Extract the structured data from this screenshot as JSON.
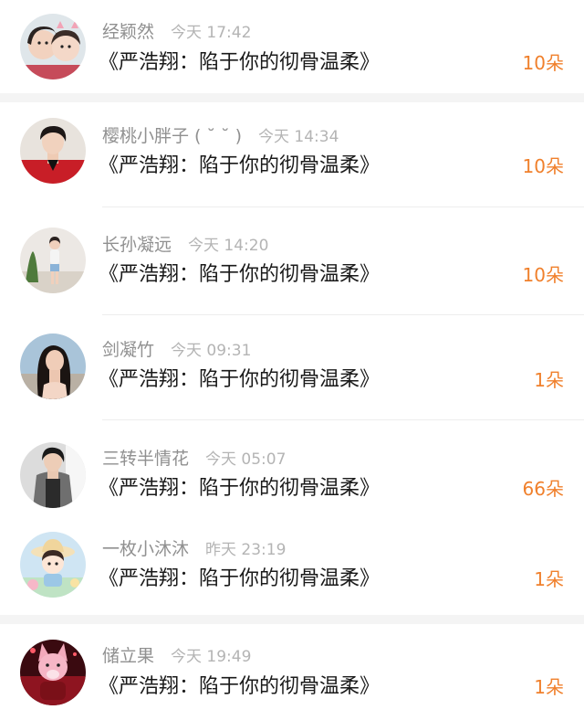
{
  "gifts": [
    {
      "name": "经颖然",
      "time": "今天 17:42",
      "title": "《严浩翔：陷于你的彻骨温柔》",
      "count": "10朵",
      "avatar_icon": "two-girls-selfie-avatar"
    },
    {
      "name": "樱桃小胖子 ( ˘ ˘ )",
      "time": "今天 14:34",
      "title": "《严浩翔：陷于你的彻骨温柔》",
      "count": "10朵",
      "avatar_icon": "boy-red-shirt-avatar"
    },
    {
      "name": "长孙凝远",
      "time": "今天 14:20",
      "title": "《严浩翔：陷于你的彻骨温柔》",
      "count": "10朵",
      "avatar_icon": "girl-full-body-avatar"
    },
    {
      "name": "剑凝竹",
      "time": "今天 09:31",
      "title": "《严浩翔：陷于你的彻骨温柔》",
      "count": "1朵",
      "avatar_icon": "girl-long-hair-avatar"
    },
    {
      "name": "三转半情花",
      "time": "今天 05:07",
      "title": "《严浩翔：陷于你的彻骨温柔》",
      "count": "66朵",
      "avatar_icon": "boy-coat-avatar"
    },
    {
      "name": "一枚小沐沐",
      "time": "昨天 23:19",
      "title": "《严浩翔：陷于你的彻骨温柔》",
      "count": "1朵",
      "avatar_icon": "cartoon-girl-hat-avatar"
    },
    {
      "name": "储立果",
      "time": "今天 19:49",
      "title": "《严浩翔：陷于你的彻骨温柔》",
      "count": "1朵",
      "avatar_icon": "pink-fox-character-avatar"
    }
  ],
  "colors": {
    "count_accent": "#f0802c",
    "name_gray": "#909090",
    "time_gray": "#b4b4b4",
    "title_black": "#1a1a1a"
  }
}
